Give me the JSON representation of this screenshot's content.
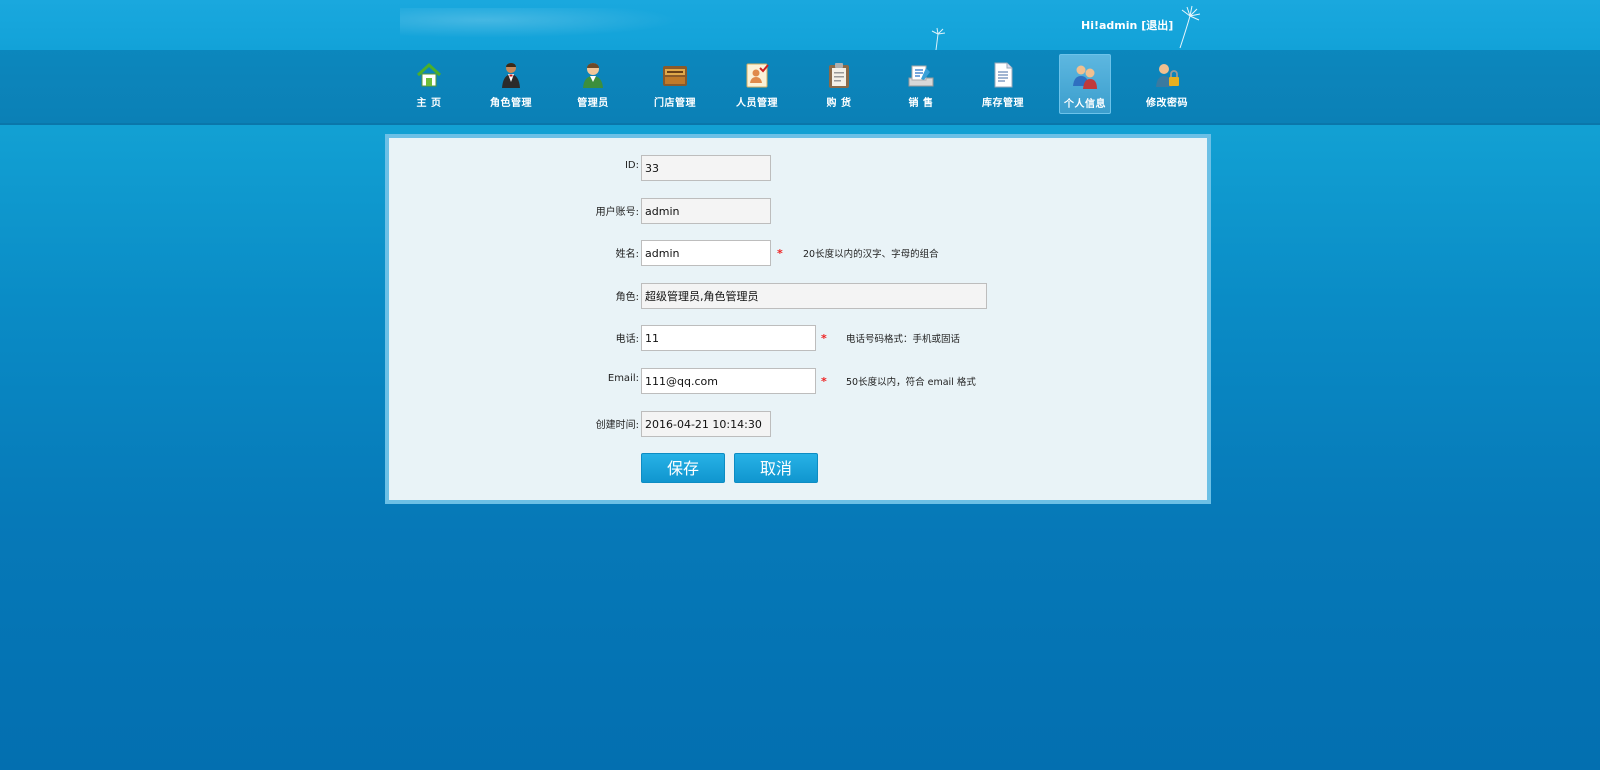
{
  "header": {
    "greeting": "Hi!",
    "username": "admin",
    "logout_label": "[退出]"
  },
  "nav": {
    "items": [
      {
        "label": "主  页",
        "icon": "home-icon"
      },
      {
        "label": "角色管理",
        "icon": "waiter-icon"
      },
      {
        "label": "管理员",
        "icon": "person-icon"
      },
      {
        "label": "门店管理",
        "icon": "store-icon"
      },
      {
        "label": "人员管理",
        "icon": "staff-icon"
      },
      {
        "label": "购  货",
        "icon": "purchase-icon"
      },
      {
        "label": "销  售",
        "icon": "sales-icon"
      },
      {
        "label": "库存管理",
        "icon": "inventory-icon"
      },
      {
        "label": "个人信息",
        "icon": "user-group-icon",
        "active": true
      },
      {
        "label": "修改密码",
        "icon": "user-lock-icon"
      }
    ]
  },
  "form": {
    "id": {
      "label": "ID:",
      "value": "33"
    },
    "account": {
      "label": "用户账号:",
      "value": "admin"
    },
    "name": {
      "label": "姓名:",
      "value": "admin",
      "required": "*",
      "hint": "20长度以内的汉字、字母的组合"
    },
    "role": {
      "label": "角色:",
      "value": "超级管理员,角色管理员"
    },
    "phone": {
      "label": "电话:",
      "value": "11",
      "required": "*",
      "hint": "电话号码格式：手机或固话"
    },
    "email": {
      "label": "Email:",
      "value": "111@qq.com",
      "required": "*",
      "hint": "50长度以内，符合 email 格式"
    },
    "created": {
      "label": "创建时间:",
      "value": "2016-04-21 10:14:30"
    }
  },
  "buttons": {
    "save": "保存",
    "cancel": "取消"
  },
  "colors": {
    "accent": "#12a2d8",
    "nav_bg": "#0c87bd",
    "panel_bg": "#e9f3f7",
    "required": "#ee2222"
  }
}
